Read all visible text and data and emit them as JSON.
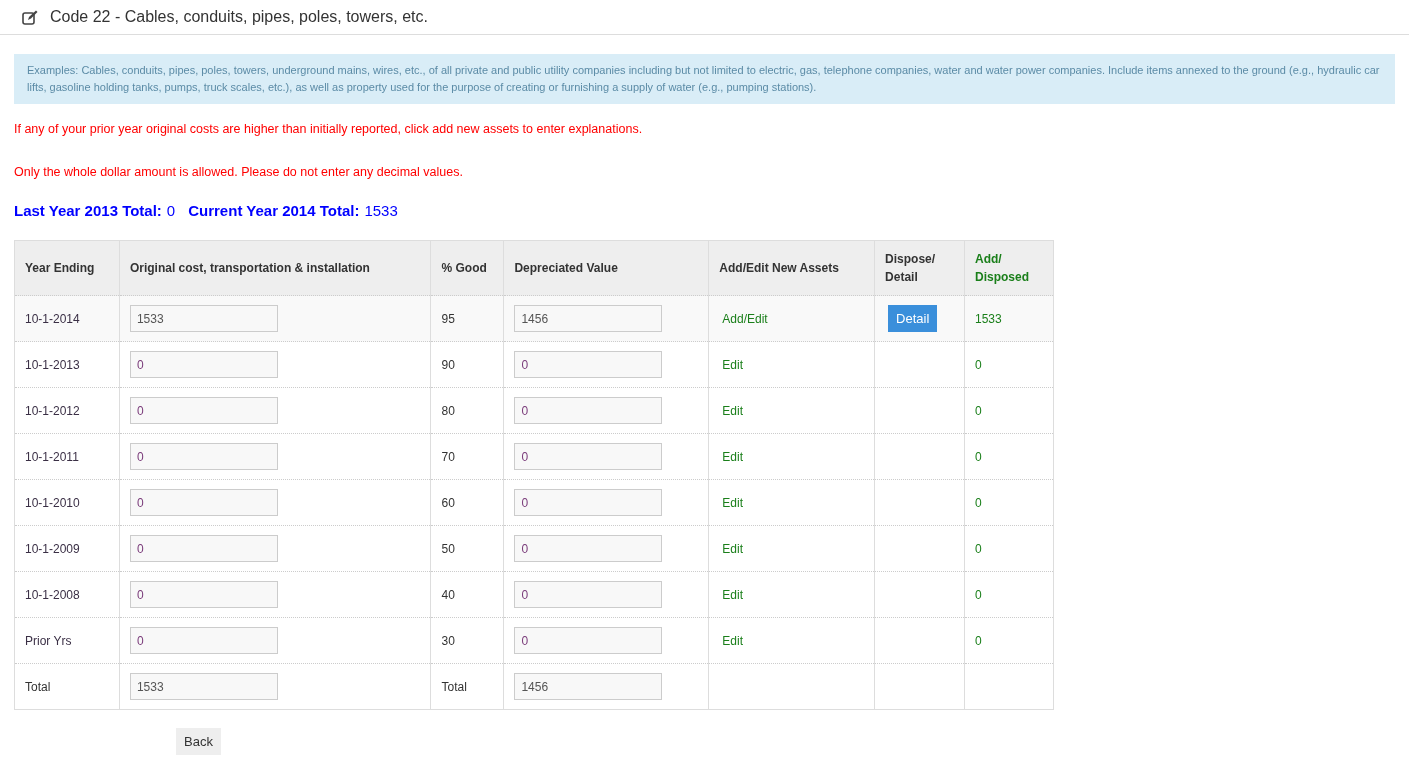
{
  "header": {
    "title": "Code 22 - Cables, conduits, pipes, poles, towers, etc."
  },
  "info_box": "Examples: Cables, conduits, pipes, poles, towers, underground mains, wires, etc., of all private and public utility companies including but not limited to electric, gas, telephone companies, water and water power companies. Include items annexed to the ground (e.g., hydraulic car lifts, gasoline holding tanks, pumps, truck scales, etc.), as well as property used for the purpose of creating or furnishing a supply of water (e.g., pumping stations).",
  "warnings": [
    "If any of your prior year original costs are higher than initially reported, click add new assets to enter explanations.",
    "Only the whole dollar amount is allowed. Please do not enter any decimal values."
  ],
  "totals": [
    {
      "label": "Last Year 2013 Total:",
      "value": "0"
    },
    {
      "label": "Current Year 2014 Total:",
      "value": "1533"
    }
  ],
  "table": {
    "columns": [
      "Year Ending",
      "Original cost, transportation & installation",
      "% Good",
      "Depreciated Value",
      "Add/Edit New Assets",
      "Dispose/ Detail",
      "Add/ Disposed"
    ],
    "rows": [
      {
        "year": "10-1-2014",
        "cost": "1533",
        "good": "95",
        "depreciated": "1456",
        "action": "Add/Edit",
        "detail": "Detail",
        "add_disposed": "1533"
      },
      {
        "year": "10-1-2013",
        "cost": "0",
        "good": "90",
        "depreciated": "0",
        "action": "Edit",
        "add_disposed": "0"
      },
      {
        "year": "10-1-2012",
        "cost": "0",
        "good": "80",
        "depreciated": "0",
        "action": "Edit",
        "add_disposed": "0"
      },
      {
        "year": "10-1-2011",
        "cost": "0",
        "good": "70",
        "depreciated": "0",
        "action": "Edit",
        "add_disposed": "0"
      },
      {
        "year": "10-1-2010",
        "cost": "0",
        "good": "60",
        "depreciated": "0",
        "action": "Edit",
        "add_disposed": "0"
      },
      {
        "year": "10-1-2009",
        "cost": "0",
        "good": "50",
        "depreciated": "0",
        "action": "Edit",
        "add_disposed": "0"
      },
      {
        "year": "10-1-2008",
        "cost": "0",
        "good": "40",
        "depreciated": "0",
        "action": "Edit",
        "add_disposed": "0"
      },
      {
        "year": "Prior Yrs",
        "cost": "0",
        "good": "30",
        "depreciated": "0",
        "action": "Edit",
        "add_disposed": "0"
      }
    ],
    "total_row": {
      "label": "Total",
      "cost": "1533",
      "good_label": "Total",
      "depreciated": "1456"
    }
  },
  "back_button": "Back"
}
